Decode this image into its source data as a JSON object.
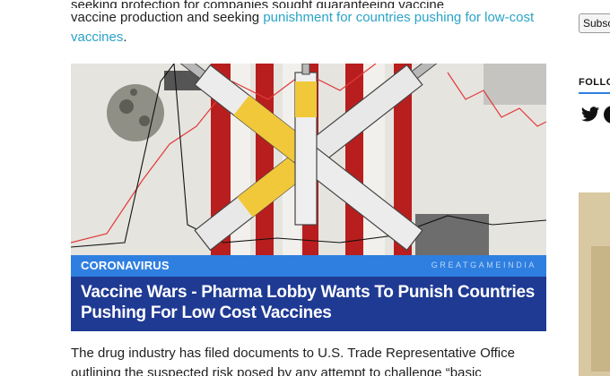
{
  "article": {
    "para_top_cut": "seeking protection for companies sought guaranteeing vaccine",
    "para_top_line2": "vaccine production and seeking ",
    "para_top_link": "punishment for countries pushing for low-cost vaccines",
    "para_top_end": ".",
    "featured": {
      "category": "CORONAVIRUS",
      "brand": "GREATGAMEINDIA",
      "headline": "Vaccine Wars - Pharma Lobby Wants To Punish Countries Pushing For Low Cost Vaccines"
    },
    "para_bottom": "The drug industry has filed documents to U.S. Trade Representative Office outlining the suspected risk posed by any attempt to challenge “basic"
  },
  "sidebar": {
    "subscribe_label": "Subscribe",
    "follow_label": "FOLLOW",
    "icons": [
      "twitter-icon",
      "social-icon"
    ]
  },
  "colors": {
    "link": "#2aa3c7",
    "category_bar": "#2f7fe0",
    "headline_bar": "#1f3a93"
  }
}
